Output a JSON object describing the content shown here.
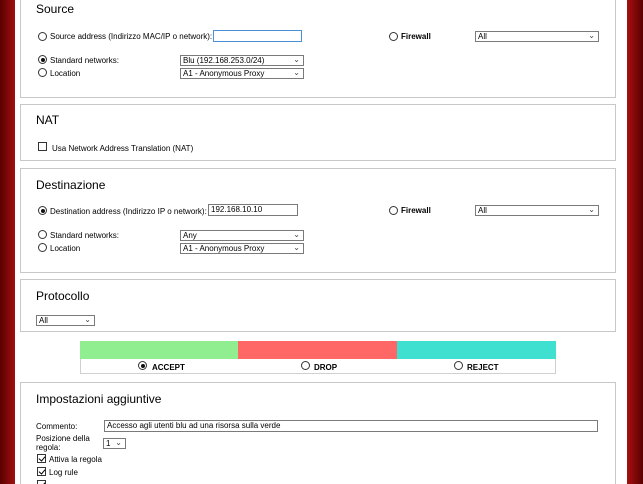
{
  "source": {
    "title": "Source",
    "address_label": "Source address (Indirizzo MAC/IP o network):",
    "address_value": "",
    "firewall_label": "Firewall",
    "firewall_value": "All",
    "standard_label": "Standard networks:",
    "standard_value": "Blu (192.168.253.0/24)",
    "location_label": "Location",
    "location_value": "A1 - Anonymous Proxy",
    "selected": "standard"
  },
  "nat": {
    "title": "NAT",
    "checkbox_label": "Usa Network Address Translation (NAT)",
    "checked": false
  },
  "destination": {
    "title": "Destinazione",
    "address_label": "Destination address (Indirizzo IP o network):",
    "address_value": "192.168.10.10",
    "firewall_label": "Firewall",
    "firewall_value": "All",
    "standard_label": "Standard networks:",
    "standard_value": "Any",
    "location_label": "Location",
    "location_value": "A1 - Anonymous Proxy",
    "selected": "address"
  },
  "protocol": {
    "title": "Protocollo",
    "value": "All"
  },
  "actions": {
    "accept_label": "ACCEPT",
    "drop_label": "DROP",
    "reject_label": "REJECT",
    "selected": "accept",
    "colors": {
      "accept": "#90ee90",
      "drop": "#ff6666",
      "reject": "#40e0d0"
    }
  },
  "extra": {
    "title": "Impostazioni aggiuntive",
    "comment_label": "Commento:",
    "comment_value": "Accesso agli utenti blu ad una risorsa sulla verde",
    "position_label_1": "Posizione della",
    "position_label_2": "regola:",
    "position_value": "1",
    "enable_label": "Attiva la regola",
    "log_label": "Log rule"
  }
}
